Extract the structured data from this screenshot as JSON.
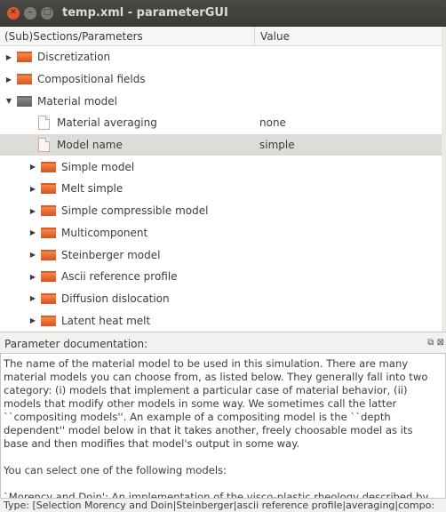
{
  "window": {
    "title": "temp.xml - parameterGUI",
    "close_glyph": "✕",
    "min_glyph": "–",
    "max_glyph": "□"
  },
  "tree": {
    "header_name": "(Sub)Sections/Parameters",
    "header_value": "Value",
    "rows": [
      {
        "label": "Discretization",
        "value": ""
      },
      {
        "label": "Compositional fields",
        "value": ""
      },
      {
        "label": "Material model",
        "value": ""
      },
      {
        "label": "Material averaging",
        "value": "none"
      },
      {
        "label": "Model name",
        "value": "simple"
      },
      {
        "label": "Simple model",
        "value": ""
      },
      {
        "label": "Melt simple",
        "value": ""
      },
      {
        "label": "Simple compressible model",
        "value": ""
      },
      {
        "label": "Multicomponent",
        "value": ""
      },
      {
        "label": "Steinberger model",
        "value": ""
      },
      {
        "label": "Ascii reference profile",
        "value": ""
      },
      {
        "label": "Diffusion dislocation",
        "value": ""
      },
      {
        "label": "Latent heat melt",
        "value": ""
      }
    ],
    "arrow_collapsed": "▶",
    "arrow_expanded": "▼"
  },
  "documentation": {
    "label": "Parameter documentation:",
    "icons": "⧉ ⊠",
    "paragraph1": "The name of the material model to be used in this simulation. There are many material models you can choose from, as listed below. They generally fall into two category: (i) models that implement a particular case of material behavior, (ii) models that modify other models in some way. We sometimes call the latter ``compositing models''. An example of a compositing model is the ``depth dependent'' model below in that it takes another, freely choosable model as its base and then modifies that model's output in some way.",
    "paragraph2": "You can select one of the following models:",
    "paragraph3": "`Morency and Doin': An implementation of the visco-plastic rheology described by"
  },
  "status": {
    "text": "Type: [Selection Morency and Doin|Steinberger|ascii reference profile|averaging|compo:"
  },
  "colors": {
    "titlebar": "#3b3a36",
    "close_button": "#e0572f",
    "selected_row": "#dedcd8",
    "folder_orange": "#e0592a"
  }
}
